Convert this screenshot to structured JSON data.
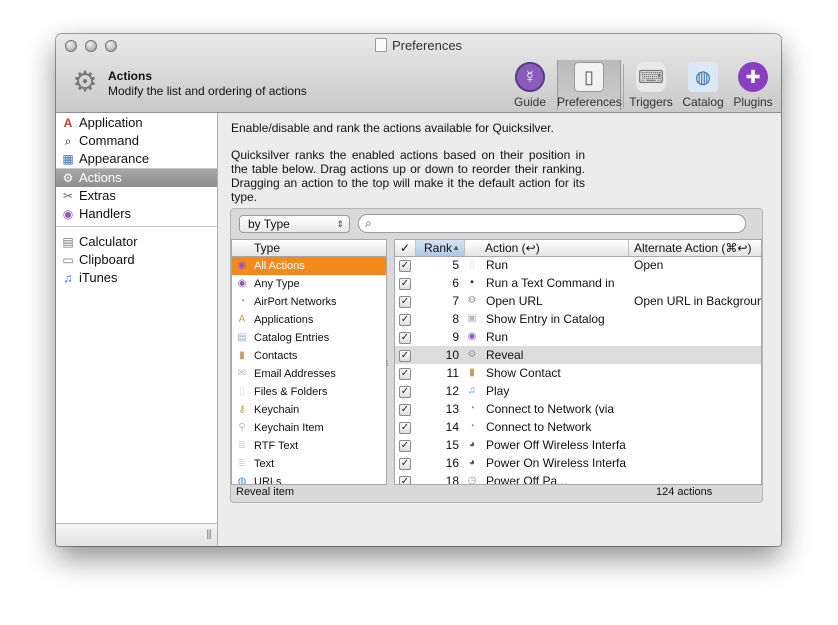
{
  "window": {
    "title": "Preferences",
    "pane_title": "Actions",
    "pane_subtitle": "Modify the list and ordering of actions"
  },
  "toolbar": [
    {
      "label": "Guide",
      "icon": "quicksilver-icon",
      "color": "#8a5bb8"
    },
    {
      "label": "Preferences",
      "icon": "preferences-icon",
      "color": "#9a9a9a"
    },
    {
      "label": "Triggers",
      "icon": "triggers-icon",
      "color": "#b0b0b0"
    },
    {
      "label": "Catalog",
      "icon": "catalog-icon",
      "color": "#4a8fd6"
    },
    {
      "label": "Plugins",
      "icon": "plugin-icon",
      "color": "#8a3fc0"
    }
  ],
  "sidebar": {
    "items": [
      {
        "label": "Application",
        "icon": "A"
      },
      {
        "label": "Command",
        "icon": "⌕"
      },
      {
        "label": "Appearance",
        "icon": "▦"
      },
      {
        "label": "Actions",
        "icon": "⚙"
      },
      {
        "label": "Extras",
        "icon": "✂"
      },
      {
        "label": "Handlers",
        "icon": "◉"
      },
      {
        "label": "Calculator",
        "icon": "▤"
      },
      {
        "label": "Clipboard",
        "icon": "▭"
      },
      {
        "label": "iTunes",
        "icon": "♫"
      }
    ]
  },
  "content": {
    "intro1": "Enable/disable and rank the actions available for Quicksilver.",
    "intro2": "Quicksilver ranks the enabled actions based on their position in the table below. Drag actions up or down to reorder their ranking. Dragging an action to the top will make it the default action for its type.",
    "sort_popup": "by Type",
    "search_placeholder": ""
  },
  "type_table": {
    "header": "Type",
    "rows": [
      {
        "label": "All Actions",
        "icon": "◉",
        "color": "#8a5bb8"
      },
      {
        "label": "Any Type",
        "icon": "◉",
        "color": "#8a5bb8"
      },
      {
        "label": "AirPort Networks",
        "icon": "◔",
        "color": "#9a9a9a"
      },
      {
        "label": "Applications",
        "icon": "A",
        "color": "#c9a14a"
      },
      {
        "label": "Catalog Entries",
        "icon": "▤",
        "color": "#9ab0c8"
      },
      {
        "label": "Contacts",
        "icon": "▮",
        "color": "#c99a5a"
      },
      {
        "label": "Email Addresses",
        "icon": "✉",
        "color": "#b8b8b8"
      },
      {
        "label": "Files & Folders",
        "icon": "▯",
        "color": "#d8d8d8"
      },
      {
        "label": "Keychain",
        "icon": "⚷",
        "color": "#c9a14a"
      },
      {
        "label": "Keychain Item",
        "icon": "⚲",
        "color": "#b8b8b8"
      },
      {
        "label": "RTF Text",
        "icon": "≣",
        "color": "#d8d8d8"
      },
      {
        "label": "Text",
        "icon": "≣",
        "color": "#d8d8d8"
      },
      {
        "label": "URLs",
        "icon": "◍",
        "color": "#4a8fd6"
      }
    ]
  },
  "actions_table": {
    "headers": {
      "check": "✓",
      "rank": "Rank",
      "action": "Action (↩)",
      "alternate": "Alternate Action (⌘↩)"
    },
    "rows": [
      {
        "rank": "5",
        "action": "Run",
        "alternate": "Open",
        "icon": "▯",
        "color": "#d8d8d8"
      },
      {
        "rank": "6",
        "action": "Run a Text Command in",
        "alternate": "",
        "icon": "▪",
        "color": "#222222"
      },
      {
        "rank": "7",
        "action": "Open URL",
        "alternate": "Open URL in Background",
        "icon": "⚙",
        "color": "#9a9a9a"
      },
      {
        "rank": "8",
        "action": "Show Entry in Catalog",
        "alternate": "",
        "icon": "▣",
        "color": "#b8b8b8"
      },
      {
        "rank": "9",
        "action": "Run",
        "alternate": "",
        "icon": "◉",
        "color": "#8a5bb8"
      },
      {
        "rank": "10",
        "action": "Reveal",
        "alternate": "",
        "icon": "⚙",
        "color": "#9a9a9a"
      },
      {
        "rank": "11",
        "action": "Show Contact",
        "alternate": "",
        "icon": "▮",
        "color": "#c99a5a"
      },
      {
        "rank": "12",
        "action": "Play",
        "alternate": "",
        "icon": "♫",
        "color": "#4a8fd6"
      },
      {
        "rank": "13",
        "action": "Connect to Network (via",
        "alternate": "",
        "icon": "◔",
        "color": "#9a9a9a"
      },
      {
        "rank": "14",
        "action": "Connect to Network",
        "alternate": "",
        "icon": "◔",
        "color": "#9a9a9a"
      },
      {
        "rank": "15",
        "action": "Power Off Wireless Interfa",
        "alternate": "",
        "icon": "◕",
        "color": "#555555"
      },
      {
        "rank": "16",
        "action": "Power On Wireless Interfa",
        "alternate": "",
        "icon": "◕",
        "color": "#555555"
      },
      {
        "rank": "18",
        "action": "Power Off Pa...",
        "alternate": "",
        "icon": "◷",
        "color": "#9a9a9a"
      }
    ]
  },
  "status": {
    "left": "Reveal item",
    "right": "124 actions"
  }
}
